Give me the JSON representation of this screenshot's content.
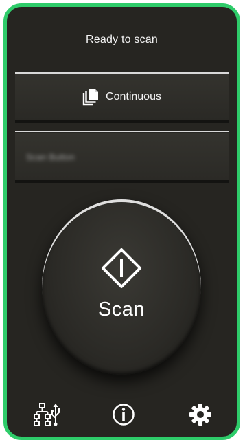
{
  "status": {
    "text": "Ready to scan"
  },
  "mode": {
    "label": "Continuous",
    "icon": "documents-icon"
  },
  "profile": {
    "label": "Scan Button"
  },
  "scan_button": {
    "label": "Scan",
    "icon": "scan-diamond-icon"
  },
  "footer": {
    "icons": [
      "network-usb-icon",
      "info-icon",
      "settings-gear-icon"
    ]
  },
  "colors": {
    "frame": "#2ecc6a",
    "background": "#262521",
    "text": "#ffffff"
  }
}
